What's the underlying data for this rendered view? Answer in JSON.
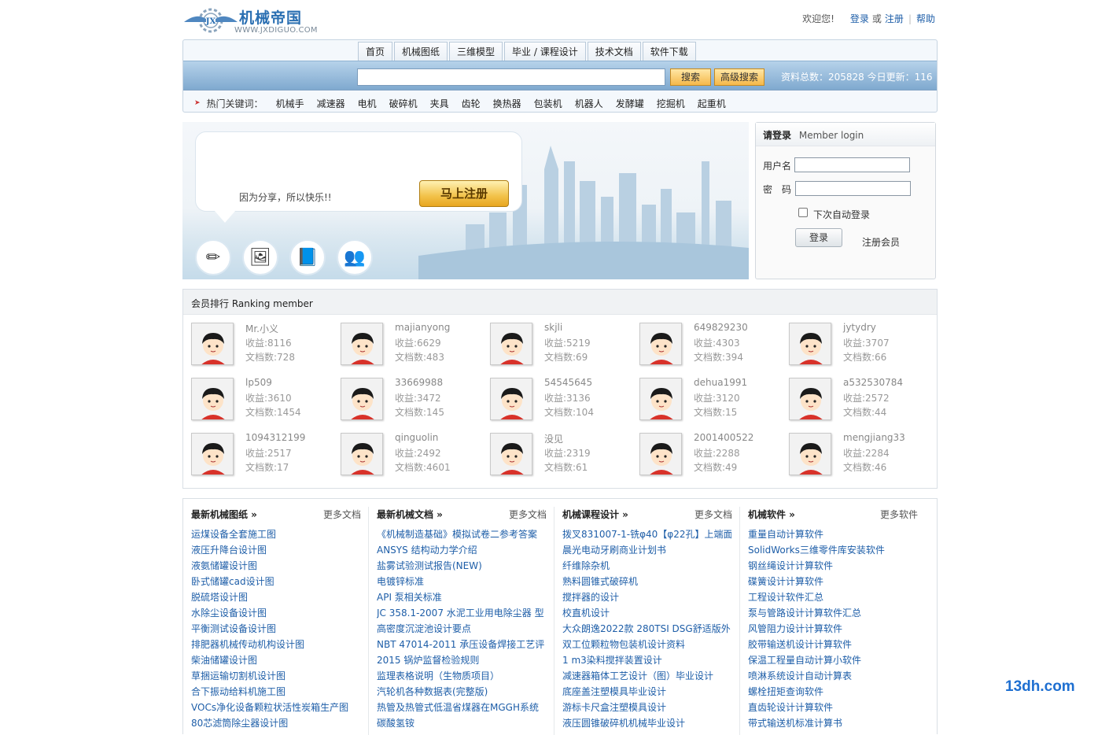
{
  "logo": {
    "title": "机械帝国",
    "badge": "JX",
    "url": "WWW.JXDIGUO.COM"
  },
  "toplinks": {
    "welcome": "欢迎您!",
    "login": "登录",
    "or": "或",
    "register": "注册",
    "help": "帮助"
  },
  "nav": {
    "tabs": [
      "首页",
      "机械图纸",
      "三维模型",
      "毕业 / 课程设计",
      "技术文档",
      "软件下载"
    ],
    "search_button": "搜索",
    "advanced_button": "高级搜索",
    "stats": "资料总数：205828 今日更新：116",
    "hot_label": "热门关键词：",
    "hot_keywords": [
      "机械手",
      "减速器",
      "电机",
      "破碎机",
      "夹具",
      "齿轮",
      "换热器",
      "包装机",
      "机器人",
      "发酵罐",
      "挖掘机",
      "起重机"
    ]
  },
  "banner": {
    "slogan": "因为分享，所以快乐!!",
    "register_button": "马上注册"
  },
  "login": {
    "title": "请登录",
    "subtitle": "Member login",
    "username_label": "用户名",
    "password_label": "密　码",
    "remember_label": "下次自动登录",
    "login_button": "登录",
    "register_link": "注册会员"
  },
  "ranking": {
    "title": "会员排行 Ranking member",
    "members": [
      {
        "name": "Mr.小义",
        "gain": "收益:8116",
        "docs": "文档数:728"
      },
      {
        "name": "majianyong",
        "gain": "收益:6629",
        "docs": "文档数:483"
      },
      {
        "name": "skjli",
        "gain": "收益:5219",
        "docs": "文档数:69"
      },
      {
        "name": "649829230",
        "gain": "收益:4303",
        "docs": "文档数:394"
      },
      {
        "name": "jytydry",
        "gain": "收益:3707",
        "docs": "文档数:66"
      },
      {
        "name": "lp509",
        "gain": "收益:3610",
        "docs": "文档数:1454"
      },
      {
        "name": "33669988",
        "gain": "收益:3472",
        "docs": "文档数:145"
      },
      {
        "name": "54545645",
        "gain": "收益:3136",
        "docs": "文档数:104"
      },
      {
        "name": "dehua1991",
        "gain": "收益:3120",
        "docs": "文档数:15"
      },
      {
        "name": "a532530784",
        "gain": "收益:2572",
        "docs": "文档数:44"
      },
      {
        "name": "1094312199",
        "gain": "收益:2517",
        "docs": "文档数:17"
      },
      {
        "name": "qinguolin",
        "gain": "收益:2492",
        "docs": "文档数:4601"
      },
      {
        "name": "没见",
        "gain": "收益:2319",
        "docs": "文档数:61"
      },
      {
        "name": "2001400522",
        "gain": "收益:2288",
        "docs": "文档数:49"
      },
      {
        "name": "mengjiang33",
        "gain": "收益:2284",
        "docs": "文档数:46"
      }
    ]
  },
  "lists": [
    {
      "title": "最新机械图纸 »",
      "more": "更多文档",
      "items": [
        "运煤设备全套施工图",
        "液压升降台设计图",
        "液氨储罐设计图",
        "卧式储罐cad设计图",
        "脱硫塔设计图",
        "水除尘设备设计图",
        "平衡测试设备设计图",
        "排肥器机械传动机构设计图",
        "柴油储罐设计图",
        "草捆运输切割机设计图",
        "合下振动给料机施工图",
        "VOCs净化设备颗粒状活性炭箱生产图",
        "80芯滤筒除尘器设计图"
      ]
    },
    {
      "title": "最新机械文档 »",
      "more": "更多文档",
      "items": [
        "《机械制造基础》模拟试卷二参考答案",
        "ANSYS 结构动力学介绍",
        "盐雾试验测试报告(NEW)",
        "电镀锌标准",
        "API 泵相关标准",
        "JC 358.1-2007 水泥工业用电除尘器 型",
        "高密度沉淀池设计要点",
        "NBT 47014-2011 承压设备焊接工艺评",
        "2015 锅炉监督检验规则",
        "监理表格说明（生物质项目）",
        "汽轮机各种数据表(完整版)",
        "热管及热管式低温省煤器在MGGH系统",
        "碳酸氢铵"
      ]
    },
    {
      "title": "机械课程设计 »",
      "more": "更多文档",
      "items": [
        "拨叉831007-1-铣φ40【φ22孔】上端面",
        "晨光电动牙刷商业计划书",
        "纤维除杂机",
        "熟料圆锥式破碎机",
        "搅拌器的设计",
        "校直机设计",
        "大众朗逸2022款 280TSI DSG舒适版外",
        "双工位颗粒物包装机设计资料",
        "1 m3染料搅拌装置设计",
        "减速器箱体工艺设计（图）毕业设计",
        "底座盖注塑模具毕业设计",
        "游标卡尺盒注塑模具设计",
        "液压圆锥破碎机机械毕业设计"
      ]
    },
    {
      "title": "机械软件 »",
      "more": "更多软件",
      "items": [
        "重量自动计算软件",
        "SolidWorks三维零件库安装软件",
        "钢丝绳设计计算软件",
        "碟簧设计计算软件",
        "工程设计软件汇总",
        "泵与管路设计计算软件汇总",
        "风管阻力设计计算软件",
        "胶带输送机设计计算软件",
        "保温工程量自动计算小软件",
        "喷淋系统设计自动计算表",
        "螺栓扭矩查询软件",
        "直齿轮设计计算软件",
        "带式输送机标准计算书"
      ]
    }
  ],
  "watermark": "13dh.com",
  "colors": {
    "brand_blue": "#2a6fb2",
    "link_blue": "#1e5ea8",
    "search_bar": "#8fb5d8",
    "button_orange": "#f5b84a"
  }
}
